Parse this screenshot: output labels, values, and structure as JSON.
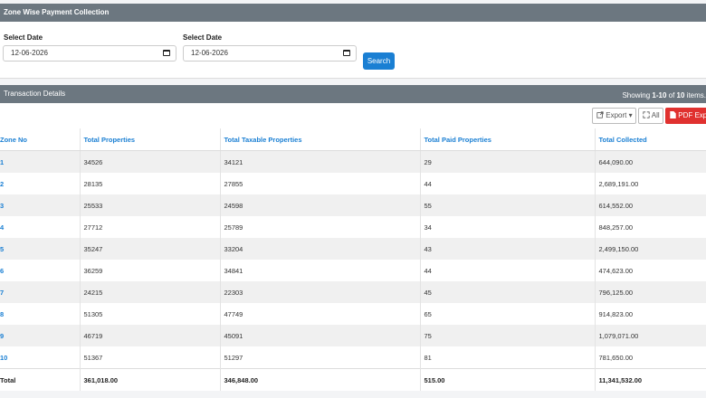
{
  "panel1": {
    "title": "Zone Wise Payment Collection"
  },
  "filters": {
    "from_label": "Select Date",
    "from_value": "12-06-2026",
    "to_label": "Select Date",
    "to_value": "12-06-2026",
    "search_label": "Search"
  },
  "panel2": {
    "title": "Transaction Details",
    "showing_prefix": "Showing ",
    "showing_range": "1-10",
    "showing_of": " of ",
    "showing_total": "10",
    "showing_suffix": " items."
  },
  "toolbar": {
    "export_label": "Export",
    "all_label": "All",
    "pdf_label": "PDF Export"
  },
  "table": {
    "headers": [
      "Zone No",
      "Total Properties",
      "Total Taxable Properties",
      "Total Paid Properties",
      "Total Collected"
    ],
    "rows": [
      [
        "1",
        "34526",
        "34121",
        "29",
        "644,090.00"
      ],
      [
        "2",
        "28135",
        "27855",
        "44",
        "2,689,191.00"
      ],
      [
        "3",
        "25533",
        "24598",
        "55",
        "614,552.00"
      ],
      [
        "4",
        "27712",
        "25789",
        "34",
        "848,257.00"
      ],
      [
        "5",
        "35247",
        "33204",
        "43",
        "2,499,150.00"
      ],
      [
        "6",
        "36259",
        "34841",
        "44",
        "474,623.00"
      ],
      [
        "7",
        "24215",
        "22303",
        "45",
        "796,125.00"
      ],
      [
        "8",
        "51305",
        "47749",
        "65",
        "914,823.00"
      ],
      [
        "9",
        "46719",
        "45091",
        "75",
        "1,079,071.00"
      ],
      [
        "10",
        "51367",
        "51297",
        "81",
        "781,650.00"
      ]
    ],
    "footer": [
      "Total",
      "361,018.00",
      "346,848.00",
      "515.00",
      "11,341,532.00"
    ]
  }
}
